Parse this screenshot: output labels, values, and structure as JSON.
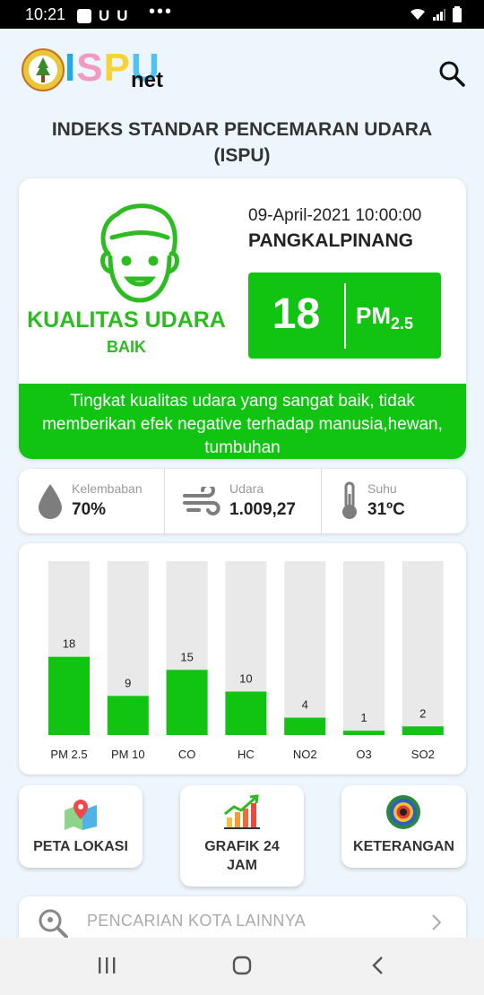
{
  "status_bar": {
    "time": "10:21",
    "notif_glyphs": [
      "U",
      "U"
    ],
    "more": "•••"
  },
  "header": {
    "logo_letters": [
      "I",
      "S",
      "P",
      "U"
    ],
    "logo_suffix": "net",
    "search_icon": "search-icon"
  },
  "page_title": "INDEKS STANDAR PENCEMARAN UDARA (ISPU)",
  "summary": {
    "quality_label": "KUALITAS UDARA",
    "quality_value": "BAIK",
    "datetime": "09-April-2021 10:00:00",
    "city": "PANGKALPINANG",
    "index_value": "18",
    "pollutant_main": "PM",
    "pollutant_sub": "2.5",
    "description": "Tingkat kualitas udara yang sangat baik, tidak memberikan efek negative terhadap manusia,hewan, tumbuhan",
    "status_color": "#12c412"
  },
  "weather": {
    "humidity_label": "Kelembaban",
    "humidity_value": "70%",
    "pressure_label": "Udara",
    "pressure_value": "1.009,27",
    "temp_label": "Suhu",
    "temp_value": "31ºC"
  },
  "chart_data": {
    "type": "bar",
    "categories": [
      "PM 2.5",
      "PM 10",
      "CO",
      "HC",
      "NO2",
      "O3",
      "SO2"
    ],
    "values": [
      18,
      9,
      15,
      10,
      4,
      1,
      2
    ],
    "data_labels": [
      "18",
      "9",
      "15",
      "10",
      "4",
      "1",
      "2"
    ],
    "ylim": [
      0,
      40
    ],
    "bar_color": "#12c412",
    "track_color": "#e9e9e9",
    "grid": false
  },
  "nav_buttons": [
    {
      "label": "PETA LOKASI",
      "icon": "map-pin-icon"
    },
    {
      "label": "GRAFIK 24 JAM",
      "icon": "bar-chart-icon"
    },
    {
      "label": "KETERANGAN",
      "icon": "color-legend-icon"
    }
  ],
  "city_search": {
    "placeholder": "PENCARIAN KOTA LAINNYA"
  },
  "system_nav": [
    "recent-apps-icon",
    "home-icon",
    "back-icon"
  ]
}
